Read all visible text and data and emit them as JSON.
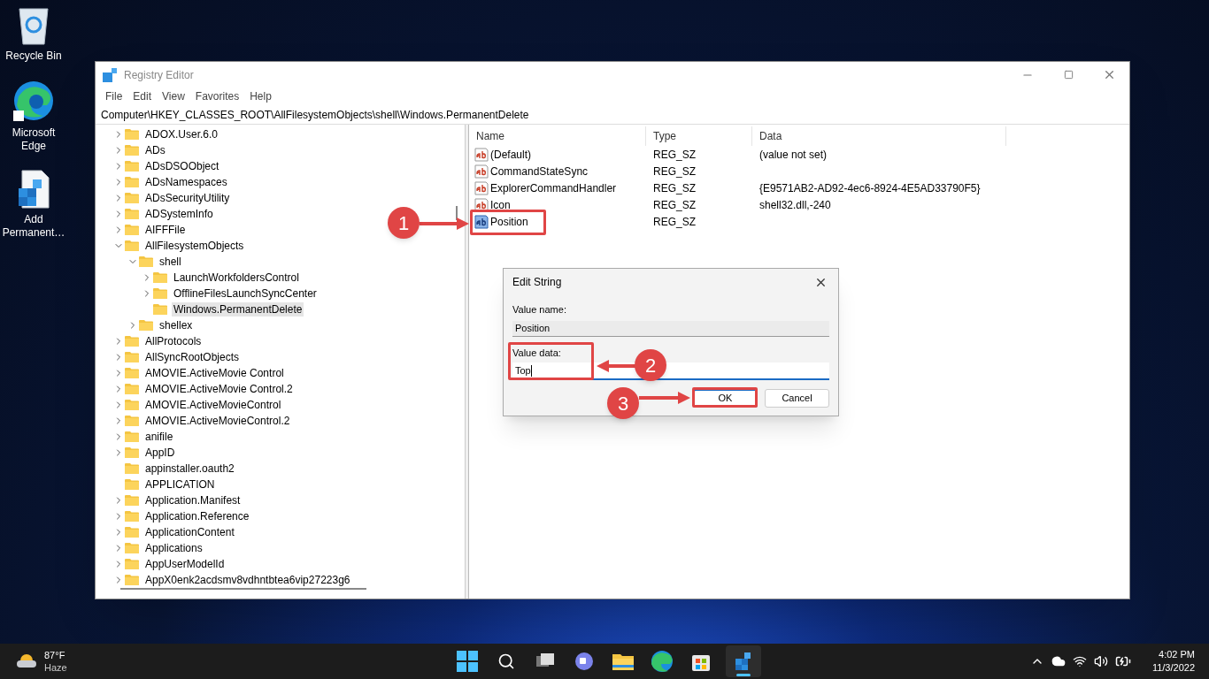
{
  "desktop_icons": [
    {
      "label": "Recycle Bin",
      "kind": "bin"
    },
    {
      "label": "Microsoft Edge",
      "kind": "edge"
    },
    {
      "label": "Add Permanent…",
      "kind": "regfile"
    }
  ],
  "window": {
    "title": "Registry Editor",
    "menu": [
      "File",
      "Edit",
      "View",
      "Favorites",
      "Help"
    ],
    "address": "Computer\\HKEY_CLASSES_ROOT\\AllFilesystemObjects\\shell\\Windows.PermanentDelete"
  },
  "tree": [
    {
      "label": "ADOX.User.6.0",
      "has_children": true,
      "expanded": false,
      "selected": false
    },
    {
      "label": "ADs",
      "has_children": true,
      "expanded": false,
      "selected": false
    },
    {
      "label": "ADsDSOObject",
      "has_children": true,
      "expanded": false,
      "selected": false
    },
    {
      "label": "ADsNamespaces",
      "has_children": true,
      "expanded": false,
      "selected": false
    },
    {
      "label": "ADsSecurityUtility",
      "has_children": true,
      "expanded": false,
      "selected": false
    },
    {
      "label": "ADSystemInfo",
      "has_children": true,
      "expanded": false,
      "selected": false
    },
    {
      "label": "AIFFFile",
      "has_children": true,
      "expanded": false,
      "selected": false
    },
    {
      "label": "AllFilesystemObjects",
      "has_children": true,
      "expanded": true,
      "selected": false,
      "children": [
        {
          "label": "shell",
          "has_children": true,
          "expanded": true,
          "selected": false,
          "children": [
            {
              "label": "LaunchWorkfoldersControl",
              "has_children": true,
              "expanded": false,
              "selected": false
            },
            {
              "label": "OfflineFilesLaunchSyncCenter",
              "has_children": true,
              "expanded": false,
              "selected": false
            },
            {
              "label": "Windows.PermanentDelete",
              "has_children": false,
              "selected": true
            }
          ]
        },
        {
          "label": "shellex",
          "has_children": true,
          "expanded": false,
          "selected": false
        }
      ]
    },
    {
      "label": "AllProtocols",
      "has_children": true,
      "expanded": false,
      "selected": false
    },
    {
      "label": "AllSyncRootObjects",
      "has_children": true,
      "expanded": false,
      "selected": false
    },
    {
      "label": "AMOVIE.ActiveMovie Control",
      "has_children": true,
      "expanded": false,
      "selected": false
    },
    {
      "label": "AMOVIE.ActiveMovie Control.2",
      "has_children": true,
      "expanded": false,
      "selected": false
    },
    {
      "label": "AMOVIE.ActiveMovieControl",
      "has_children": true,
      "expanded": false,
      "selected": false
    },
    {
      "label": "AMOVIE.ActiveMovieControl.2",
      "has_children": true,
      "expanded": false,
      "selected": false
    },
    {
      "label": "anifile",
      "has_children": true,
      "expanded": false,
      "selected": false
    },
    {
      "label": "AppID",
      "has_children": true,
      "expanded": false,
      "selected": false
    },
    {
      "label": "appinstaller.oauth2",
      "has_children": false,
      "selected": false
    },
    {
      "label": "APPLICATION",
      "has_children": false,
      "selected": false
    },
    {
      "label": "Application.Manifest",
      "has_children": true,
      "expanded": false,
      "selected": false
    },
    {
      "label": "Application.Reference",
      "has_children": true,
      "expanded": false,
      "selected": false
    },
    {
      "label": "ApplicationContent",
      "has_children": true,
      "expanded": false,
      "selected": false
    },
    {
      "label": "Applications",
      "has_children": true,
      "expanded": false,
      "selected": false
    },
    {
      "label": "AppUserModelId",
      "has_children": true,
      "expanded": false,
      "selected": false
    },
    {
      "label": "AppX0enk2acdsmv8vdhntbtea6vip27223g6",
      "has_children": true,
      "expanded": false,
      "selected": false
    }
  ],
  "values": {
    "columns": [
      "Name",
      "Type",
      "Data"
    ],
    "rows": [
      {
        "name": "(Default)",
        "type": "REG_SZ",
        "data": "(value not set)",
        "selected": false
      },
      {
        "name": "CommandStateSync",
        "type": "REG_SZ",
        "selected": false
      },
      {
        "name": "ExplorerCommandHandler",
        "type": "REG_SZ",
        "data": "{E9571AB2-AD92-4ec6-8924-4E5AD33790F5}",
        "selected": false
      },
      {
        "name": "Icon",
        "type": "REG_SZ",
        "data": "shell32.dll,-240",
        "selected": false
      },
      {
        "name": "Position",
        "type": "REG_SZ",
        "selected": true
      }
    ]
  },
  "dialog": {
    "title": "Edit String",
    "value_name_label": "Value name:",
    "value_name": "Position",
    "value_data_label": "Value data:",
    "value_data": "Top",
    "buttons": [
      {
        "label": "OK",
        "default": true
      },
      {
        "label": "Cancel",
        "default": false
      }
    ]
  },
  "annotations": [
    {
      "label": "1"
    },
    {
      "label": "2"
    },
    {
      "label": "3"
    }
  ],
  "taskbar": {
    "temperature": "87°F",
    "weather": "Haze",
    "time": "4:02 PM",
    "date": "11/3/2022"
  }
}
